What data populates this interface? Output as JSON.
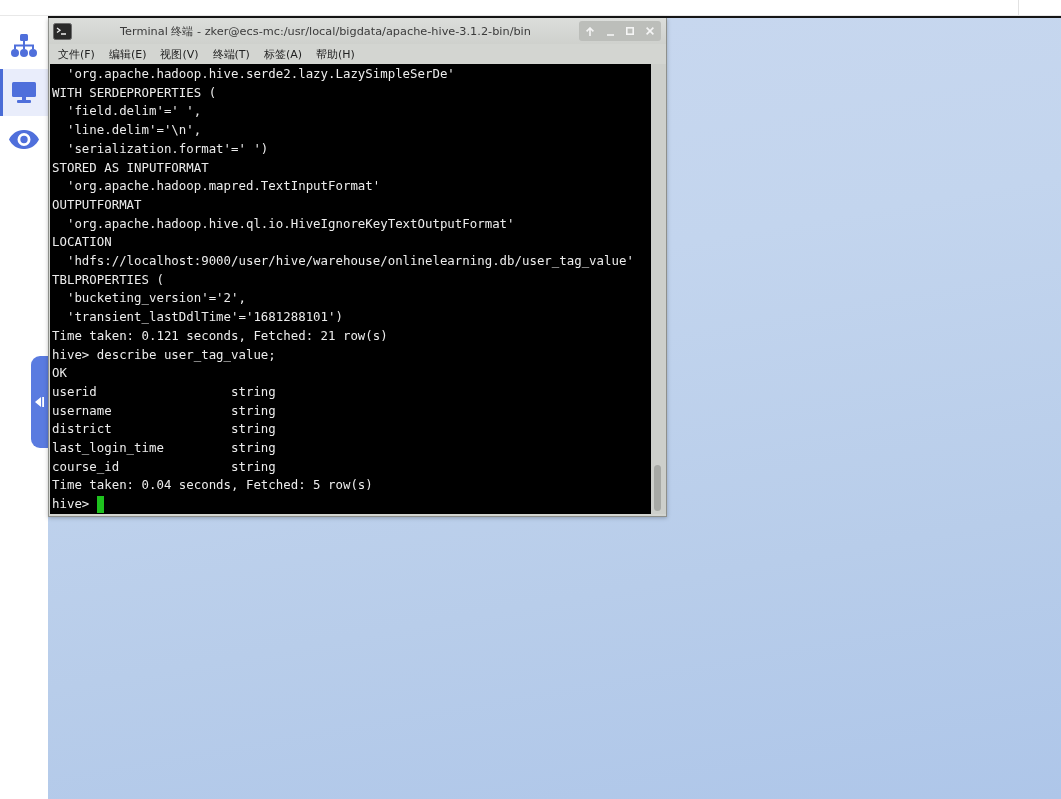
{
  "sidebar": {
    "items": [
      {
        "selected": false
      },
      {
        "selected": true
      },
      {
        "selected": false
      }
    ]
  },
  "terminal": {
    "title": "Terminal 终端 - zker@ecs-mc:/usr/local/bigdata/apache-hive-3.1.2-bin/bin",
    "menu": [
      "文件(F)",
      "编辑(E)",
      "视图(V)",
      "终端(T)",
      "标签(A)",
      "帮助(H)"
    ],
    "lines": [
      "  'org.apache.hadoop.hive.serde2.lazy.LazySimpleSerDe'",
      "WITH SERDEPROPERTIES (",
      "  'field.delim'=' ',",
      "  'line.delim'='\\n',",
      "  'serialization.format'=' ')",
      "STORED AS INPUTFORMAT",
      "  'org.apache.hadoop.mapred.TextInputFormat'",
      "OUTPUTFORMAT",
      "  'org.apache.hadoop.hive.ql.io.HiveIgnoreKeyTextOutputFormat'",
      "LOCATION",
      "  'hdfs://localhost:9000/user/hive/warehouse/onlinelearning.db/user_tag_value'",
      "TBLPROPERTIES (",
      "  'bucketing_version'='2',",
      "  'transient_lastDdlTime'='1681288101')",
      "Time taken: 0.121 seconds, Fetched: 21 row(s)",
      "hive> describe user_tag_value;",
      "OK",
      "userid                  string",
      "username                string",
      "district                string",
      "last_login_time         string",
      "course_id               string",
      "Time taken: 0.04 seconds, Fetched: 5 row(s)"
    ],
    "prompt": "hive>"
  }
}
